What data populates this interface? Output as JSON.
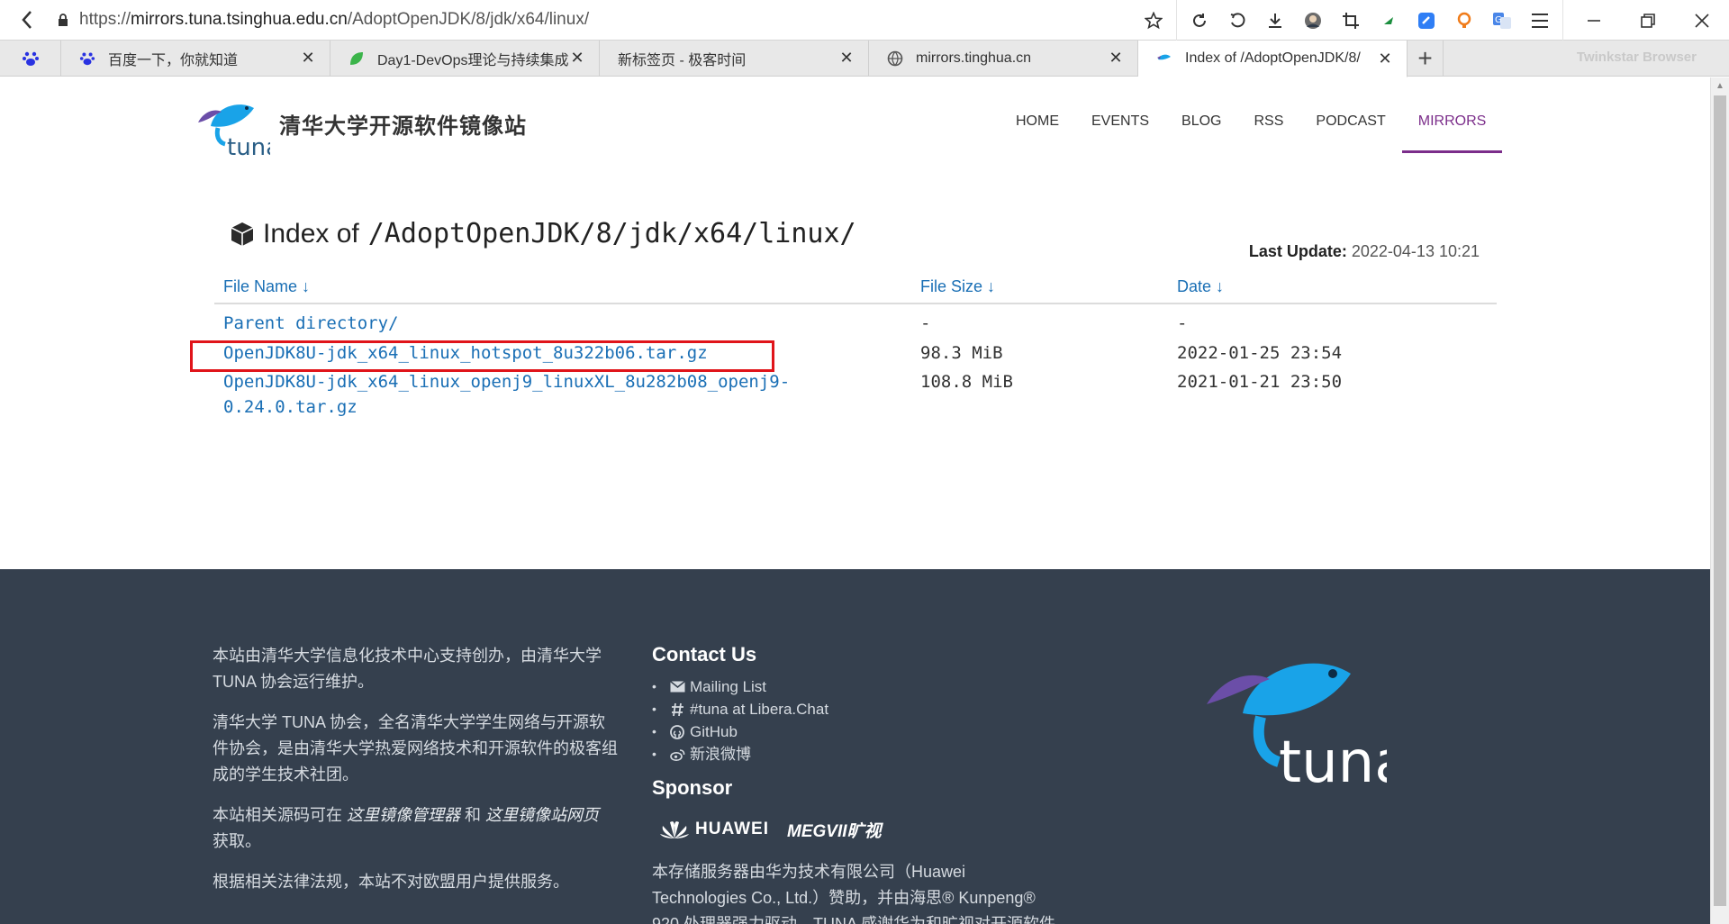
{
  "browser": {
    "url_prefix": "https://",
    "url_host": "mirrors.tuna.tsinghua.edu.cn",
    "url_path": "/AdoptOpenJDK/8/jdk/x64/linux/",
    "brand": "Twinkstar Browser",
    "tabs": [
      {
        "title": "百度一下，你就知道",
        "icon": "baidu-paw-icon",
        "active": false
      },
      {
        "title": "Day1-DevOps理论与持续集成",
        "icon": "leaf-icon",
        "active": false
      },
      {
        "title": "新标签页 - 极客时间",
        "icon": "",
        "active": false
      },
      {
        "title": "mirrors.tinghua.cn",
        "icon": "globe-icon",
        "active": false
      },
      {
        "title": "Index of /AdoptOpenJDK/8/",
        "icon": "tuna-fish-icon",
        "active": true
      }
    ],
    "close_glyph": "✕",
    "new_tab_glyph": "+"
  },
  "header": {
    "site_title": "清华大学开源软件镜像站",
    "nav": [
      {
        "label": "HOME",
        "active": false
      },
      {
        "label": "EVENTS",
        "active": false
      },
      {
        "label": "BLOG",
        "active": false
      },
      {
        "label": "RSS",
        "active": false
      },
      {
        "label": "PODCAST",
        "active": false
      },
      {
        "label": "MIRRORS",
        "active": true
      }
    ]
  },
  "index": {
    "title_prefix": "Index of",
    "path": "/AdoptOpenJDK/8/jdk/x64/linux/",
    "last_update_label": "Last Update:",
    "last_update_value": "2022-04-13 10:21",
    "columns": {
      "name": "File Name ↓",
      "size": "File Size ↓",
      "date": "Date ↓"
    },
    "rows": [
      {
        "name": "Parent directory/",
        "size": "-",
        "date": "-"
      },
      {
        "name": "OpenJDK8U-jdk_x64_linux_hotspot_8u322b06.tar.gz",
        "size": "98.3 MiB",
        "date": "2022-01-25 23:54"
      },
      {
        "name_line1": "OpenJDK8U-jdk_x64_linux_openj9_linuxXL_8u282b08_openj9-",
        "name_line2": "0.24.0.tar.gz",
        "size": "108.8 MiB",
        "date": "2021-01-21 23:50"
      }
    ]
  },
  "footer": {
    "left": {
      "p1": "本站由清华大学信息化技术中心支持创办，由清华大学 TUNA 协会运行维护。",
      "p2": "清华大学 TUNA 协会，全名清华大学学生网络与开源软件协会，是由清华大学热爱网络技术和开源软件的极客组成的学生技术社团。",
      "p3_a": "本站相关源码可在 ",
      "p3_link1": "这里镜像管理器",
      "p3_b": " 和 ",
      "p3_link2": "这里镜像站网页",
      "p3_c": " 获取。",
      "p4": "根据相关法律法规，本站不对欧盟用户提供服务。"
    },
    "contact": {
      "heading": "Contact Us",
      "items": [
        {
          "label": "Mailing List",
          "icon": "envelope-icon"
        },
        {
          "label": "#tuna at Libera.Chat",
          "icon": "hash-icon"
        },
        {
          "label": "GitHub",
          "icon": "github-icon"
        },
        {
          "label": "新浪微博",
          "icon": "weibo-icon"
        }
      ]
    },
    "sponsor": {
      "heading": "Sponsor",
      "huawei": "HUAWEI",
      "megvii": "MEGVII旷视",
      "text": "本存储服务器由华为技术有限公司（Huawei Technologies Co., Ltd.）赞助，并由海思® Kunpeng® 920 处理器强力驱动。TUNA 感谢华为和旷视对开源软件和社区的贡献。"
    }
  },
  "colors": {
    "link": "#1a6fb5",
    "nav_active": "#7b2d8a",
    "footer_bg": "#35404e",
    "highlight": "#e0141a"
  }
}
